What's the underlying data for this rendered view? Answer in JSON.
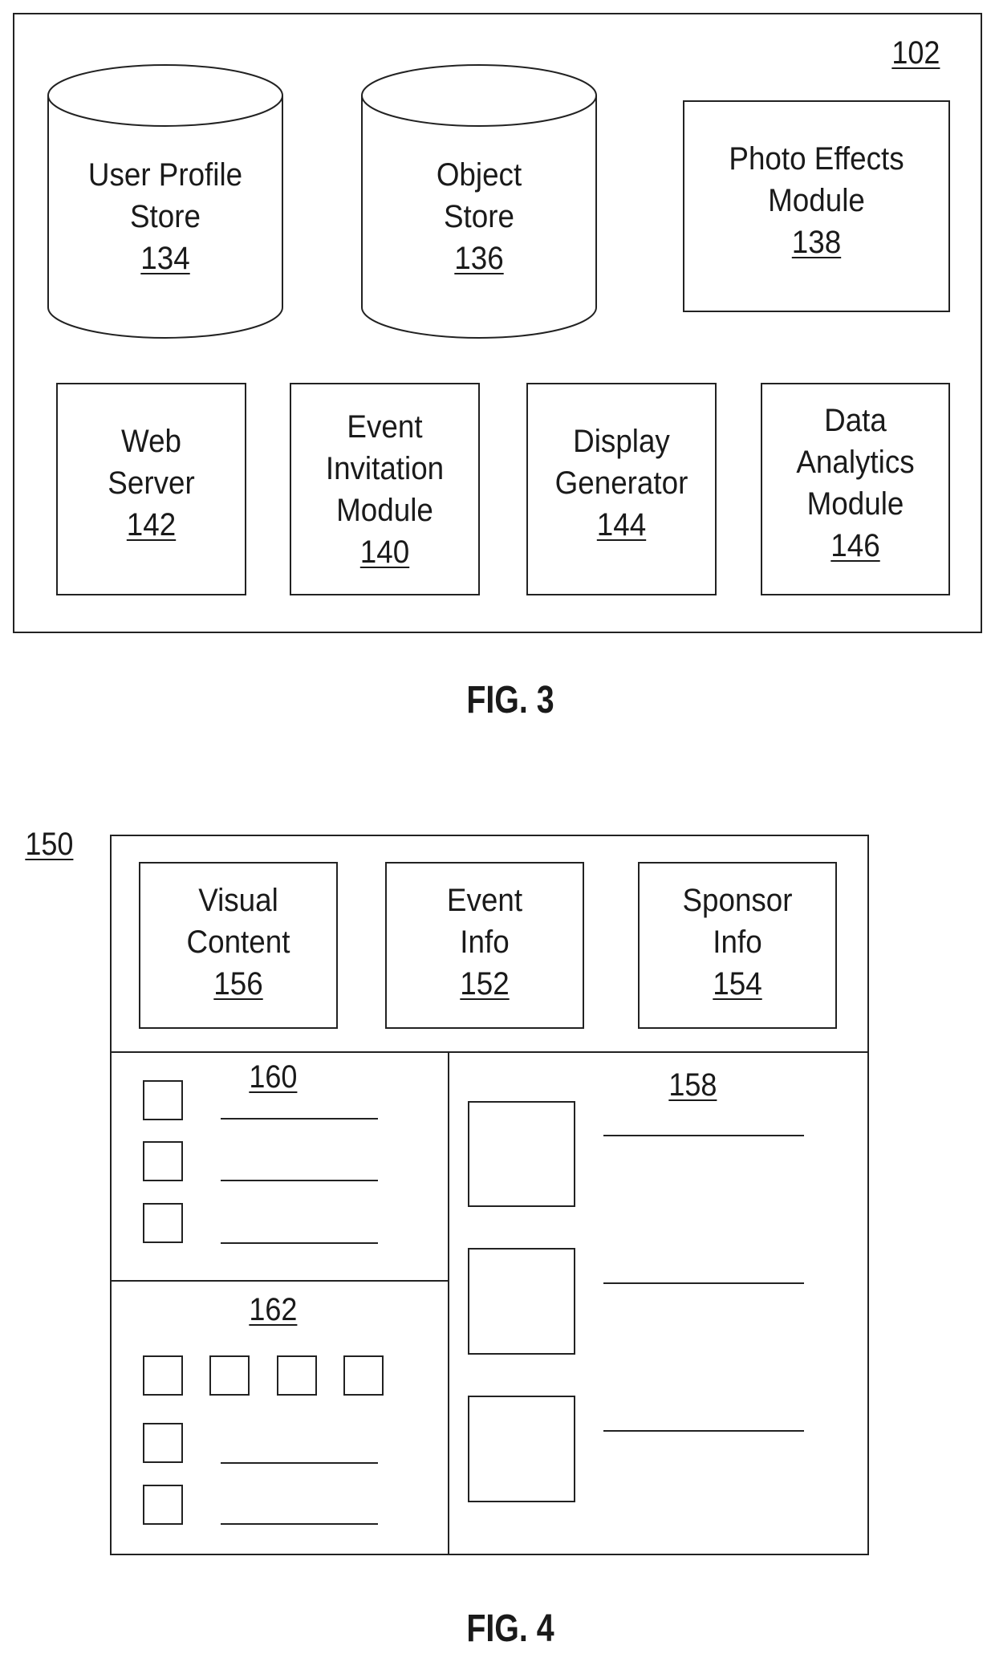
{
  "fig3": {
    "caption": "FIG. 3",
    "system_ref": "102",
    "stores": [
      {
        "lines": [
          "User Profile",
          "Store"
        ],
        "ref": "134"
      },
      {
        "lines": [
          "Object",
          "Store"
        ],
        "ref": "136"
      }
    ],
    "photo_module": {
      "lines": [
        "Photo Effects",
        "Module"
      ],
      "ref": "138"
    },
    "modules": [
      {
        "lines": [
          "Web",
          "Server"
        ],
        "ref": "142"
      },
      {
        "lines": [
          "Event",
          "Invitation",
          "Module"
        ],
        "ref": "140"
      },
      {
        "lines": [
          "Display",
          "Generator"
        ],
        "ref": "144"
      },
      {
        "lines": [
          "Data",
          "Analytics",
          "Module"
        ],
        "ref": "146"
      }
    ]
  },
  "fig4": {
    "caption": "FIG. 4",
    "page_ref": "150",
    "top_boxes": [
      {
        "lines": [
          "Visual",
          "Content"
        ],
        "ref": "156"
      },
      {
        "lines": [
          "Event",
          "Info"
        ],
        "ref": "152"
      },
      {
        "lines": [
          "Sponsor",
          "Info"
        ],
        "ref": "154"
      }
    ],
    "panel_160_ref": "160",
    "panel_162_ref": "162",
    "panel_158_ref": "158"
  }
}
